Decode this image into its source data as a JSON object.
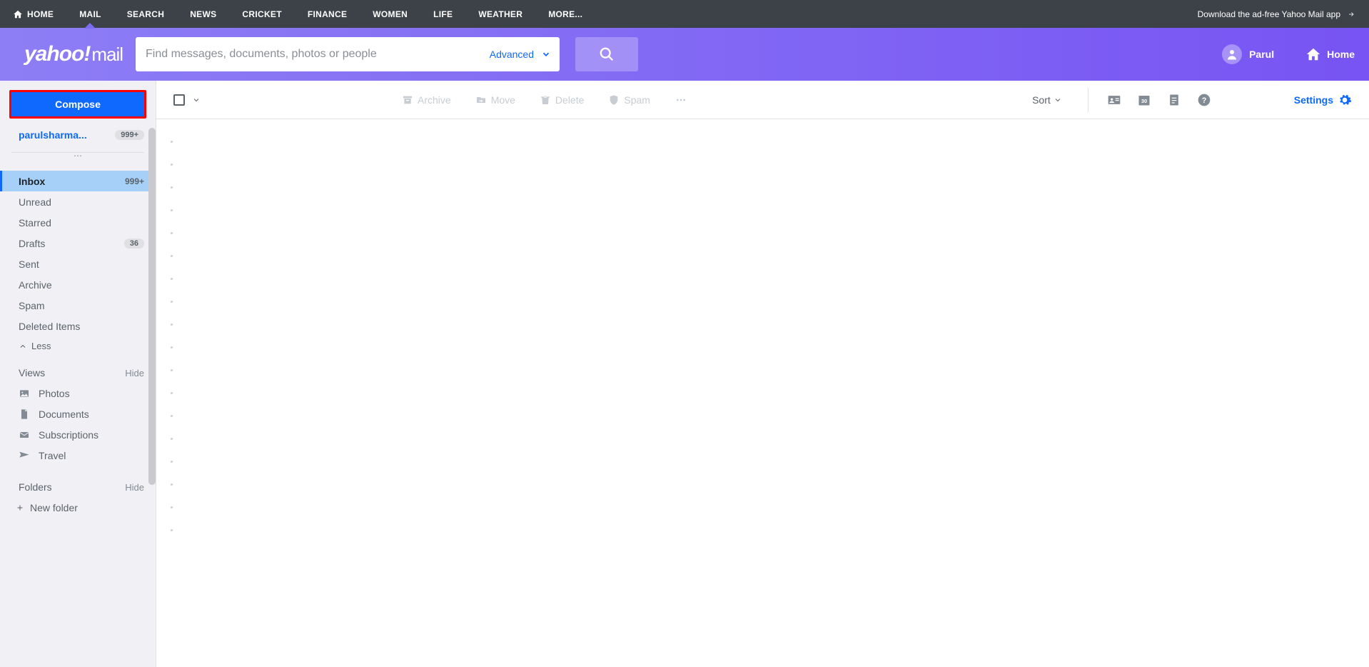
{
  "topnav": {
    "items": [
      "HOME",
      "MAIL",
      "SEARCH",
      "NEWS",
      "CRICKET",
      "FINANCE",
      "WOMEN",
      "LIFE",
      "WEATHER",
      "MORE..."
    ],
    "active_index": 1,
    "promo": "Download the ad-free Yahoo Mail app"
  },
  "header": {
    "logo_main": "yahoo!",
    "logo_suffix": "mail",
    "search_placeholder": "Find messages, documents, photos or people",
    "advanced_label": "Advanced",
    "user_name": "Parul",
    "home_label": "Home"
  },
  "sidebar": {
    "compose_label": "Compose",
    "account_name": "parulsharma...",
    "account_count": "999+",
    "folders": [
      {
        "name": "Inbox",
        "count": "999+",
        "active": true
      },
      {
        "name": "Unread",
        "count": "",
        "active": false
      },
      {
        "name": "Starred",
        "count": "",
        "active": false
      },
      {
        "name": "Drafts",
        "count": "36",
        "active": false,
        "pill": true
      },
      {
        "name": "Sent",
        "count": "",
        "active": false
      },
      {
        "name": "Archive",
        "count": "",
        "active": false
      },
      {
        "name": "Spam",
        "count": "",
        "active": false
      },
      {
        "name": "Deleted Items",
        "count": "",
        "active": false
      }
    ],
    "less_label": "Less",
    "views_label": "Views",
    "hide_label": "Hide",
    "views": [
      {
        "name": "Photos",
        "icon": "image-icon"
      },
      {
        "name": "Documents",
        "icon": "document-icon"
      },
      {
        "name": "Subscriptions",
        "icon": "mail-icon"
      },
      {
        "name": "Travel",
        "icon": "plane-icon"
      }
    ],
    "folders_label": "Folders",
    "new_folder_label": "New folder"
  },
  "toolbar": {
    "archive_label": "Archive",
    "move_label": "Move",
    "delete_label": "Delete",
    "spam_label": "Spam",
    "sort_label": "Sort",
    "settings_label": "Settings"
  }
}
